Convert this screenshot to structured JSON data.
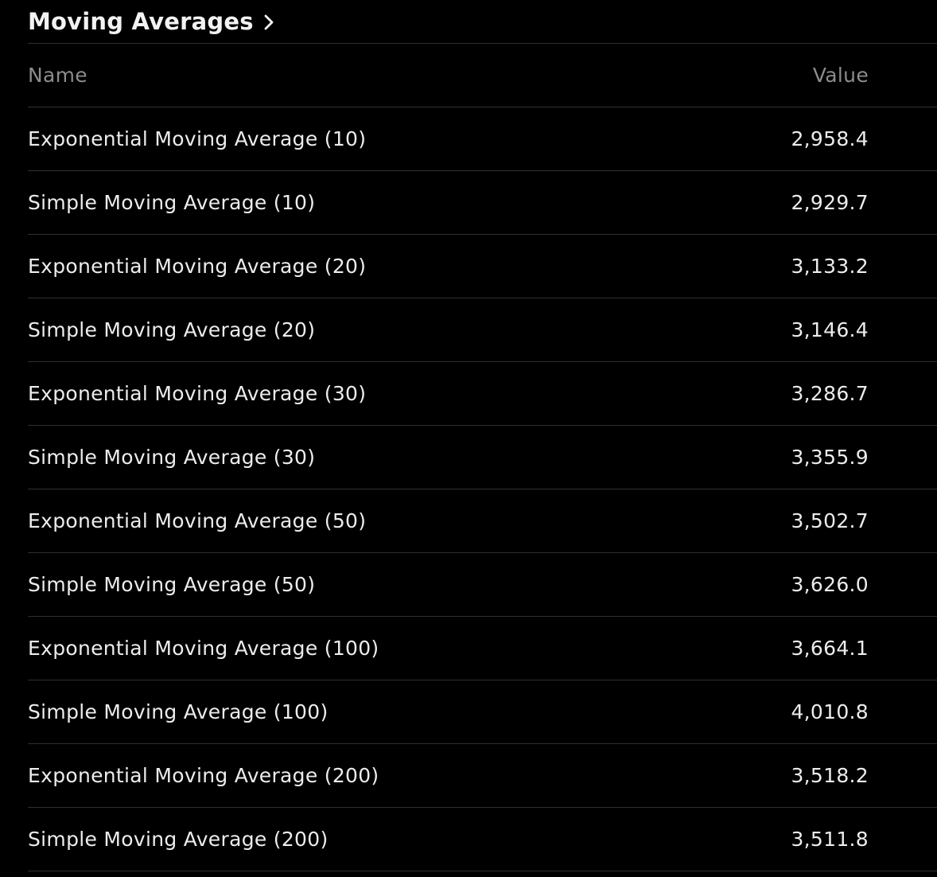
{
  "section": {
    "title": "Moving Averages",
    "chevron_icon": "chevron-right-icon"
  },
  "table": {
    "headers": {
      "name": "Name",
      "value": "Value"
    },
    "rows": [
      {
        "name": "Exponential Moving Average (10)",
        "value": "2,958.4"
      },
      {
        "name": "Simple Moving Average (10)",
        "value": "2,929.7"
      },
      {
        "name": "Exponential Moving Average (20)",
        "value": "3,133.2"
      },
      {
        "name": "Simple Moving Average (20)",
        "value": "3,146.4"
      },
      {
        "name": "Exponential Moving Average (30)",
        "value": "3,286.7"
      },
      {
        "name": "Simple Moving Average (30)",
        "value": "3,355.9"
      },
      {
        "name": "Exponential Moving Average (50)",
        "value": "3,502.7"
      },
      {
        "name": "Simple Moving Average (50)",
        "value": "3,626.0"
      },
      {
        "name": "Exponential Moving Average (100)",
        "value": "3,664.1"
      },
      {
        "name": "Simple Moving Average (100)",
        "value": "4,010.8"
      },
      {
        "name": "Exponential Moving Average (200)",
        "value": "3,518.2"
      },
      {
        "name": "Simple Moving Average (200)",
        "value": "3,511.8"
      }
    ]
  },
  "colors": {
    "background": "#000000",
    "text": "#ececec",
    "header_text": "#8c8c8c",
    "divider": "#2f2f2f"
  }
}
